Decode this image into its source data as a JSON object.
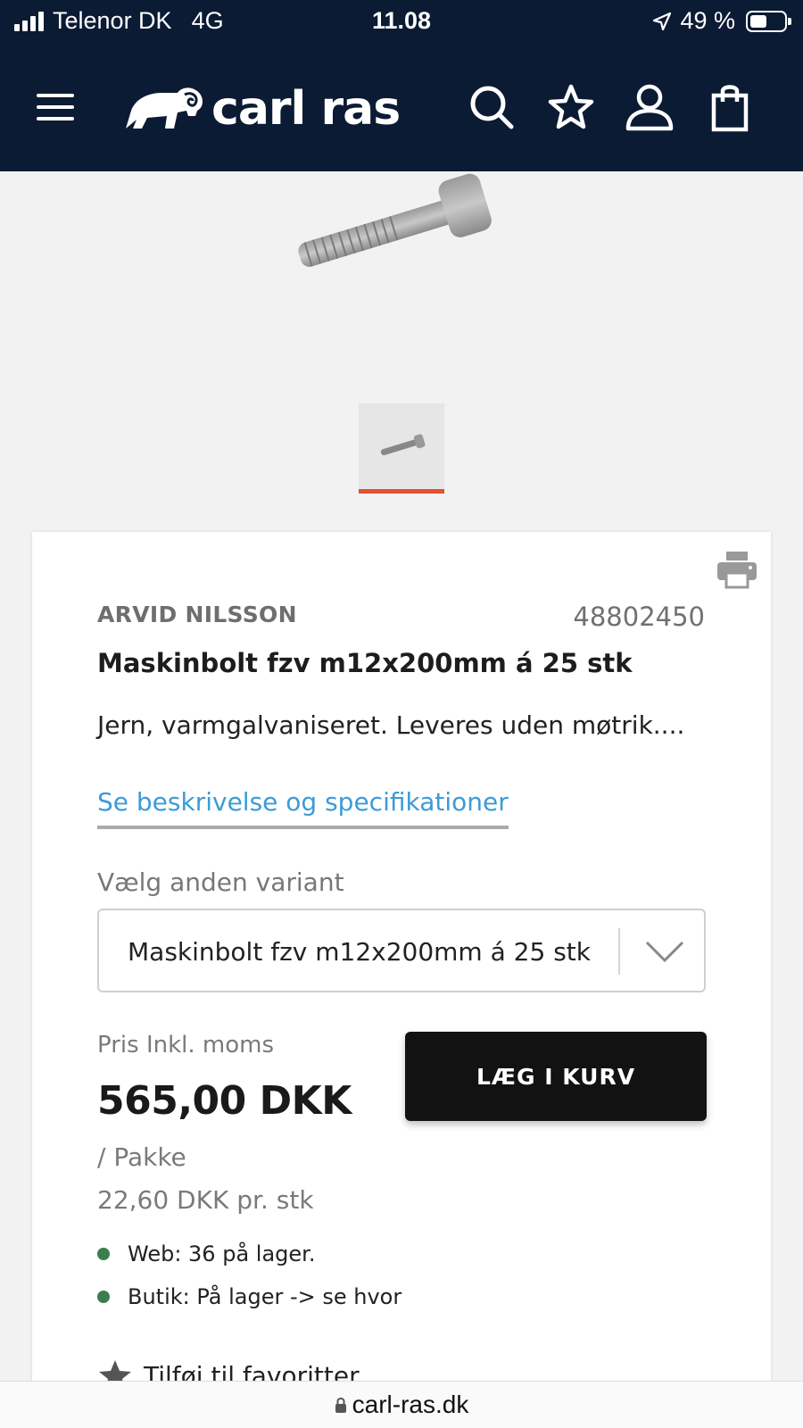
{
  "status_bar": {
    "carrier": "Telenor DK",
    "network": "4G",
    "time": "11.08",
    "battery": "49 %",
    "battery_level": 0.49
  },
  "header": {
    "logo_text": "carl ras",
    "icons": [
      "menu-icon",
      "search-icon",
      "star-icon",
      "user-icon",
      "bag-icon"
    ]
  },
  "product": {
    "brand": "ARVID NILSSON",
    "sku": "48802450",
    "title": "Maskinbolt fzv m12x200mm á 25 stk",
    "short_description": "Jern, varmgalvaniseret. Leveres uden møtrik....",
    "spec_link": "Se beskrivelse og specifikationer",
    "variant_label": "Vælg anden variant",
    "variant_selected": "Maskinbolt fzv m12x200mm á 25 stk",
    "price_label": "Pris Inkl. moms",
    "price": "565,00 DKK",
    "unit": "/ Pakke",
    "price_per_piece": "22,60 DKK pr. stk",
    "add_to_cart": "LÆG I KURV",
    "stock": [
      {
        "text": "Web: 36 på lager.",
        "color": "#3c7d4e"
      },
      {
        "text": "Butik: På lager -> se hvor",
        "color": "#3c7d4e"
      }
    ],
    "favorite": "Tilføj til favoritter"
  },
  "colors": {
    "header_bg": "#0b1b33",
    "link": "#3b9bd8",
    "accent": "#e5502e",
    "button_bg": "#121212",
    "stock_dot": "#3c7d4e"
  },
  "browser": {
    "url": "carl-ras.dk"
  }
}
